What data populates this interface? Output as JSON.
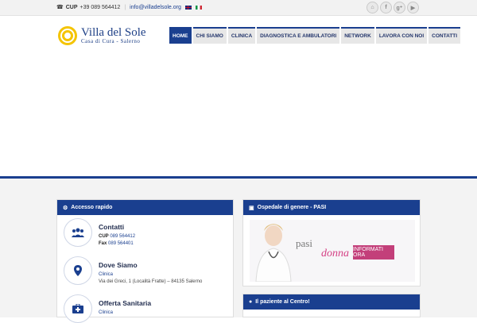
{
  "topbar": {
    "cup_label": "CUP",
    "cup_number": "+39 089 564412",
    "email": "info@villadelsole.org",
    "social_icons": [
      "home-icon",
      "facebook-icon",
      "google-plus-icon",
      "youtube-icon"
    ],
    "social_glyphs": [
      "⌂",
      "f",
      "g⁺",
      "▶"
    ]
  },
  "logo": {
    "name": "Villa del Sole",
    "tagline": "Casa di Cura - Salerno"
  },
  "nav": {
    "items": [
      {
        "label": "HOME",
        "active": true
      },
      {
        "label": "CHI SIAMO"
      },
      {
        "label": "CLINICA"
      },
      {
        "label": "DIAGNOSTICA E AMBULATORI"
      },
      {
        "label": "NETWORK"
      },
      {
        "label": "LAVORA CON NOI"
      },
      {
        "label": "CONTATTI"
      }
    ]
  },
  "accesso": {
    "title": "Accesso rapido",
    "contatti": {
      "title": "Contatti",
      "cup_label": "CUP",
      "cup": "089 564412",
      "fax_label": "Fax",
      "fax": "089 564401"
    },
    "dove": {
      "title": "Dove Siamo",
      "line1": "Clinica",
      "line2": "Via dei Greci, 1 (Località Fratte) – 84135 Salerno"
    },
    "offerta": {
      "title": "Offerta Sanitaria",
      "line1": "Clinica"
    }
  },
  "ospedale": {
    "title": "Ospedale di genere - PASI",
    "pasi": "pasi",
    "donna": "donna",
    "button": "INFORMATI ORA"
  },
  "paziente": {
    "title": "Il paziente al Centro!"
  },
  "colors": {
    "brand_blue": "#1a3f8f",
    "pink": "#c33f7a",
    "nav_bg": "#e7e7e7"
  }
}
